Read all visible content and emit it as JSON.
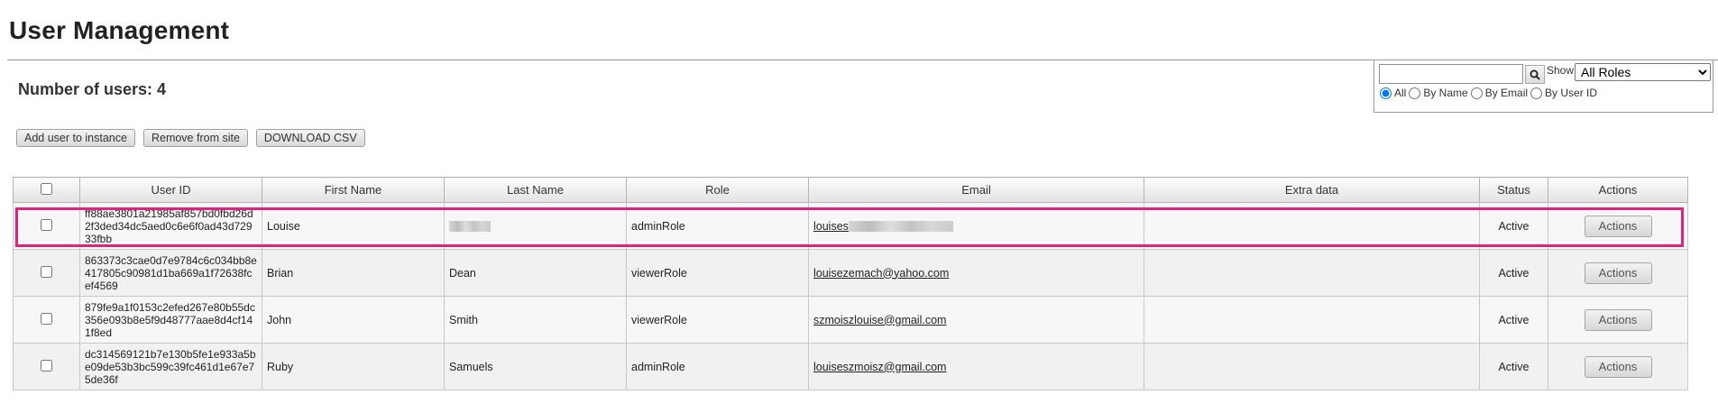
{
  "page": {
    "title": "User Management"
  },
  "summary": {
    "user_count_label": "Number of users: 4"
  },
  "search": {
    "query": "",
    "show_label": "Show:",
    "role_selected": "All Roles",
    "filters": [
      {
        "label": "All",
        "checked": true
      },
      {
        "label": "By Name",
        "checked": false
      },
      {
        "label": "By Email",
        "checked": false
      },
      {
        "label": "By User ID",
        "checked": false
      }
    ]
  },
  "toolbar": {
    "add_label": "Add user to instance",
    "remove_label": "Remove from site",
    "download_label": "DOWNLOAD CSV"
  },
  "table": {
    "columns": [
      "",
      "User ID",
      "First Name",
      "Last Name",
      "Role",
      "Email",
      "Extra data",
      "Status",
      "Actions"
    ],
    "rows": [
      {
        "user_id": "ff88ae3801a21985af857bd0fbd26d2f3ded34dc5aed0c6e6f0ad43d72933fbb",
        "first_name": "Louise",
        "last_name": "",
        "last_name_redacted": true,
        "role": "adminRole",
        "email": "louises",
        "email_redacted": true,
        "extra": "",
        "status": "Active",
        "action_label": "Actions",
        "highlighted": true
      },
      {
        "user_id": "863373c3cae0d7e9784c6c034bb8e417805c90981d1ba669a1f72638fcef4569",
        "first_name": "Brian",
        "last_name": "Dean",
        "role": "viewerRole",
        "email": "louisezemach@yahoo.com",
        "extra": "",
        "status": "Active",
        "action_label": "Actions"
      },
      {
        "user_id": "879fe9a1f0153c2efed267e80b55dc356e093b8e5f9d48777aae8d4cf141f8ed",
        "first_name": "John",
        "last_name": "Smith",
        "role": "viewerRole",
        "email": "szmoiszlouise@gmail.com",
        "extra": "",
        "status": "Active",
        "action_label": "Actions"
      },
      {
        "user_id": "dc314569121b7e130b5fe1e933a5be09de53b3bc599c39fc461d1e67e75de36f",
        "first_name": "Ruby",
        "last_name": "Samuels",
        "role": "adminRole",
        "email": "louiseszmoisz@gmail.com",
        "extra": "",
        "status": "Active",
        "action_label": "Actions"
      }
    ]
  },
  "colors": {
    "highlight": "#e0247c",
    "header_bg": "#e2e2e2"
  }
}
